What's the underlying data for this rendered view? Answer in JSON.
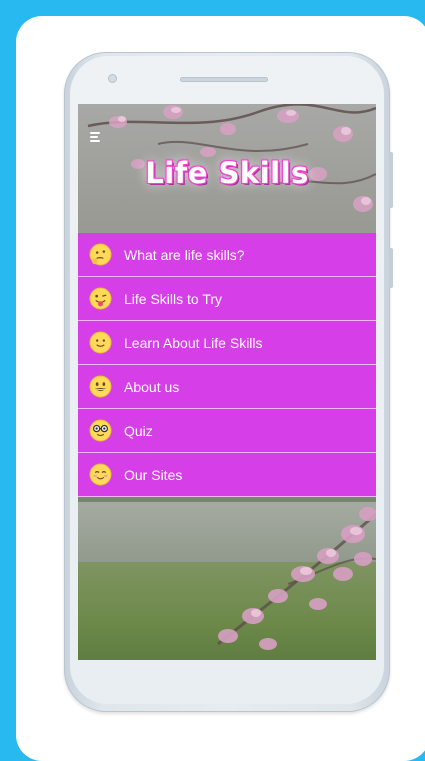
{
  "app": {
    "title": "Life Skills"
  },
  "header": {
    "menu_icon": "hamburger-menu-icon"
  },
  "menu": {
    "items": [
      {
        "label": "What are life skills?",
        "icon": "thinking-face-icon"
      },
      {
        "label": "Life Skills to Try",
        "icon": "winking-tongue-face-icon"
      },
      {
        "label": "Learn About Life Skills",
        "icon": "smiling-face-icon"
      },
      {
        "label": "About us",
        "icon": "grinning-face-icon"
      },
      {
        "label": "Quiz",
        "icon": "nerd-face-icon"
      },
      {
        "label": "Our Sites",
        "icon": "blushing-face-icon"
      }
    ]
  },
  "colors": {
    "page_background": "#28b9f0",
    "menu_item_background": "#d63ee8",
    "menu_item_divider": "#f2b5f8",
    "logo_glow": "#e23ec8",
    "emoji_yellow": "#ffd95a"
  }
}
